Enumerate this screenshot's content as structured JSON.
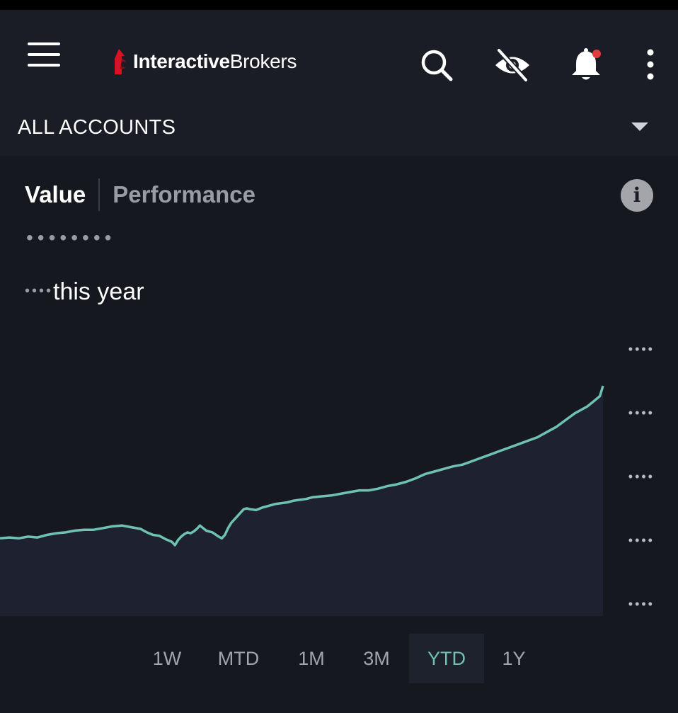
{
  "header": {
    "logo_bold": "Interactive",
    "logo_regular": "Brokers"
  },
  "account": {
    "label": "ALL ACCOUNTS"
  },
  "tabs": [
    {
      "label": "Value",
      "active": true
    },
    {
      "label": "Performance",
      "active": false
    }
  ],
  "summary": {
    "masked_value": "••••••••",
    "masked_change": "••••",
    "change_suffix": "this year"
  },
  "chart": {
    "y_ticks": [
      "••••",
      "••••",
      "••••",
      "••••",
      "••••"
    ],
    "line_color": "#6fc2b3",
    "area_color": "#1e2130",
    "points": [
      [
        0,
        0.32
      ],
      [
        3,
        0.33
      ],
      [
        6,
        0.32
      ],
      [
        9,
        0.34
      ],
      [
        12,
        0.33
      ],
      [
        15,
        0.36
      ],
      [
        18,
        0.38
      ],
      [
        21,
        0.39
      ],
      [
        24,
        0.41
      ],
      [
        27,
        0.42
      ],
      [
        30,
        0.42
      ],
      [
        33,
        0.44
      ],
      [
        36,
        0.46
      ],
      [
        39,
        0.47
      ],
      [
        42,
        0.45
      ],
      [
        45,
        0.43
      ],
      [
        47,
        0.39
      ],
      [
        49,
        0.36
      ],
      [
        51,
        0.35
      ],
      [
        53,
        0.31
      ],
      [
        55,
        0.28
      ],
      [
        56,
        0.24
      ],
      [
        57,
        0.3
      ],
      [
        58,
        0.34
      ],
      [
        59,
        0.37
      ],
      [
        60,
        0.39
      ],
      [
        61,
        0.38
      ],
      [
        62,
        0.4
      ],
      [
        63,
        0.43
      ],
      [
        64,
        0.47
      ],
      [
        65,
        0.44
      ],
      [
        66,
        0.41
      ],
      [
        68,
        0.39
      ],
      [
        70,
        0.34
      ],
      [
        71,
        0.32
      ],
      [
        72,
        0.36
      ],
      [
        73,
        0.44
      ],
      [
        74,
        0.5
      ],
      [
        75,
        0.54
      ],
      [
        76,
        0.58
      ],
      [
        77,
        0.62
      ],
      [
        78,
        0.66
      ],
      [
        79,
        0.67
      ],
      [
        80,
        0.66
      ],
      [
        82,
        0.65
      ],
      [
        84,
        0.68
      ],
      [
        86,
        0.7
      ],
      [
        88,
        0.72
      ],
      [
        90,
        0.73
      ],
      [
        92,
        0.74
      ],
      [
        94,
        0.76
      ],
      [
        96,
        0.77
      ],
      [
        98,
        0.78
      ],
      [
        100,
        0.8
      ],
      [
        103,
        0.81
      ],
      [
        106,
        0.82
      ],
      [
        109,
        0.84
      ],
      [
        112,
        0.86
      ],
      [
        115,
        0.88
      ],
      [
        118,
        0.88
      ],
      [
        121,
        0.9
      ],
      [
        124,
        0.93
      ],
      [
        127,
        0.95
      ],
      [
        130,
        0.98
      ],
      [
        133,
        1.02
      ],
      [
        136,
        1.07
      ],
      [
        139,
        1.1
      ],
      [
        142,
        1.13
      ],
      [
        145,
        1.16
      ],
      [
        148,
        1.18
      ],
      [
        151,
        1.22
      ],
      [
        154,
        1.26
      ],
      [
        157,
        1.3
      ],
      [
        160,
        1.34
      ],
      [
        163,
        1.38
      ],
      [
        166,
        1.42
      ],
      [
        169,
        1.46
      ],
      [
        172,
        1.5
      ],
      [
        175,
        1.56
      ],
      [
        178,
        1.62
      ],
      [
        181,
        1.7
      ],
      [
        184,
        1.78
      ],
      [
        186,
        1.82
      ],
      [
        188,
        1.86
      ],
      [
        190,
        1.92
      ],
      [
        192,
        1.98
      ],
      [
        193,
        2.1
      ]
    ]
  },
  "periods": [
    {
      "label": "1W",
      "selected": false
    },
    {
      "label": "MTD",
      "selected": false
    },
    {
      "label": "1M",
      "selected": false
    },
    {
      "label": "3M",
      "selected": false
    },
    {
      "label": "YTD",
      "selected": true
    },
    {
      "label": "1Y",
      "selected": false
    }
  ]
}
